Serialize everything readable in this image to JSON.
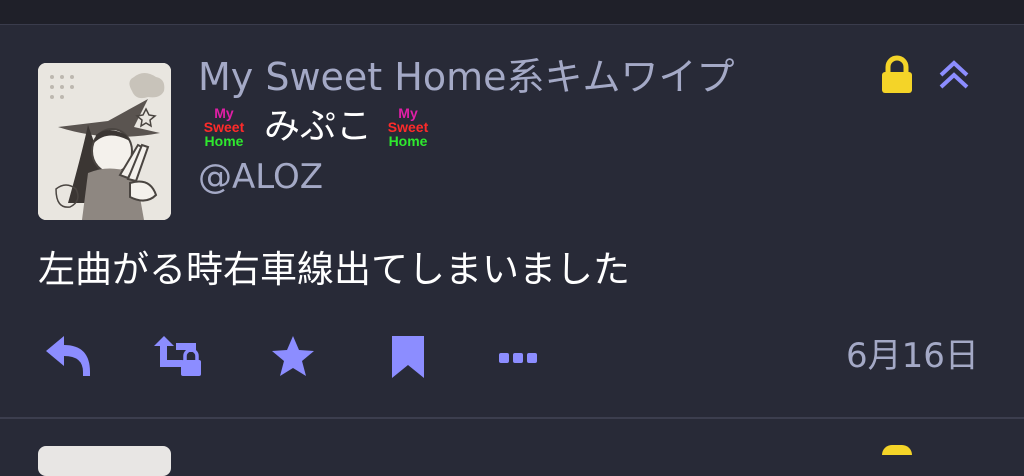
{
  "status": {
    "display_name": "My Sweet Home系キムワイプ",
    "name": "みぷこ",
    "badge": {
      "line1": "My",
      "line2": "Sweet",
      "line3": "Home"
    },
    "username": "@ALOZ",
    "content": "左曲がる時右車線出てしまいました",
    "timestamp": "6月16日",
    "visibility_icon": "lock-icon",
    "collapse_icon": "chevron-double-up-icon"
  },
  "actions": [
    {
      "name": "reply",
      "icon": "reply-icon"
    },
    {
      "name": "boost",
      "icon": "boost-locked-icon"
    },
    {
      "name": "favourite",
      "icon": "star-icon"
    },
    {
      "name": "bookmark",
      "icon": "bookmark-icon"
    },
    {
      "name": "more",
      "icon": "ellipsis-icon"
    }
  ],
  "colors": {
    "background": "#282a37",
    "muted_text": "#a4a9c6",
    "icon": "#8c8dff",
    "lock": "#f4d428",
    "badge_my": "#e01fa6",
    "badge_sweet": "#ff2a2a",
    "badge_home": "#2ee82e"
  }
}
